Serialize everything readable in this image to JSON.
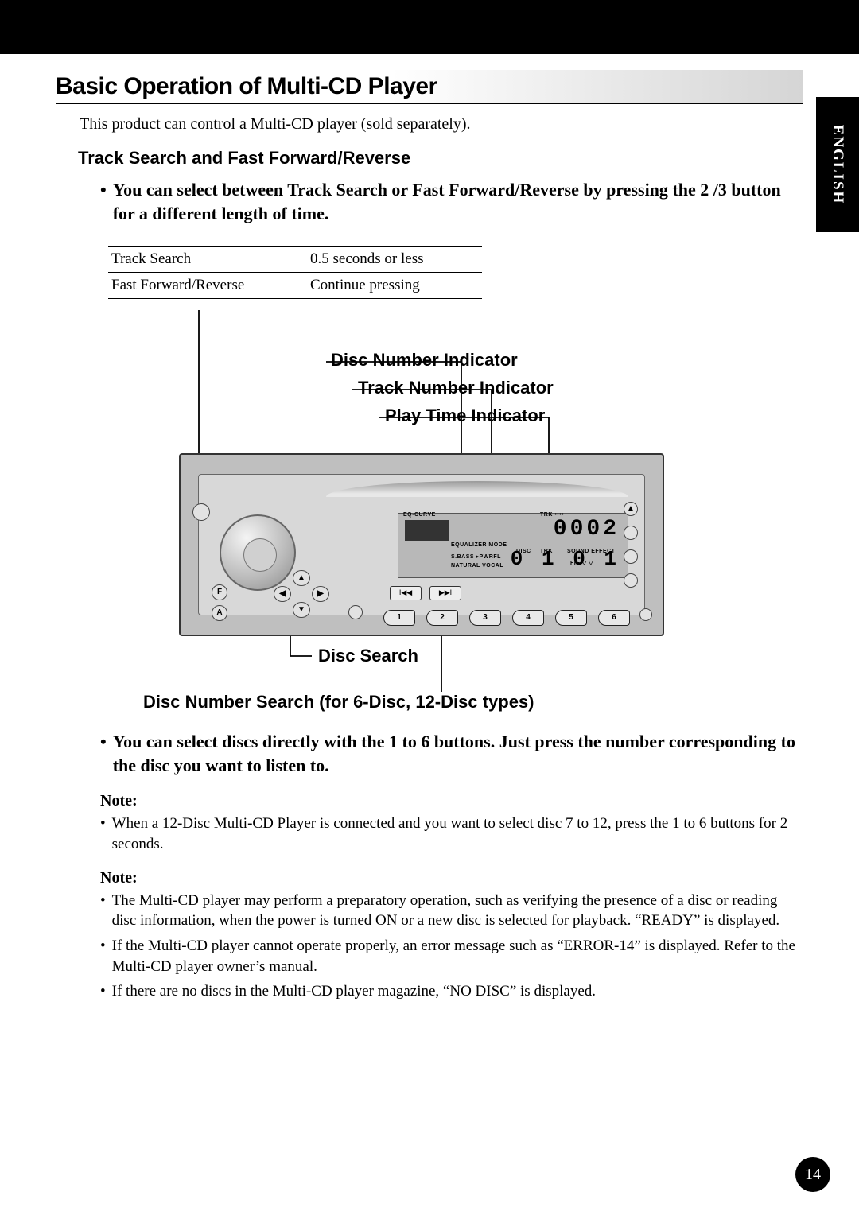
{
  "sideTab": "ENGLISH",
  "pageNumber": "14",
  "title": "Basic Operation of Multi-CD Player",
  "intro": "This product can control a Multi-CD player (sold separately).",
  "sub1": "Track Search and Fast Forward/Reverse",
  "bold1_pre": "You can select between Track Search or Fast Forward/Reverse by pressing the ",
  "bold1_btn": "2 /3",
  "bold1_post": "  button for a different length of time.",
  "table": {
    "r1c1": "Track Search",
    "r1c2": "0.5 seconds or less",
    "r2c1": "Fast Forward/Reverse",
    "r2c2": "Continue pressing"
  },
  "callouts": {
    "discNum": "Disc Number Indicator",
    "trackNum": "Track Number Indicator",
    "playTime": "Play Time Indicator",
    "discSearch": "Disc Search",
    "discNumSearch": "Disc Number Search (for 6-Disc, 12-Disc types)"
  },
  "lcd": {
    "segTop": "0002",
    "segBot": "0 1 0 1",
    "eqLabel": "EQ-CURVE",
    "equalizerMode": "EQUALIZER MODE",
    "sbass": "S.BASS  ▸PWRFL",
    "natural": "NATURAL  VOCAL",
    "disc": "DISC",
    "trk": "TRK",
    "soundEffect": "SOUND EFFECT",
    "fie": "FIE  ▽ ▽"
  },
  "knob_labels": {
    "f": "F",
    "a": "A"
  },
  "presets": [
    "1",
    "2",
    "3",
    "4",
    "5",
    "6"
  ],
  "midBtns": {
    "prev": "I◀◀",
    "next": "▶▶I"
  },
  "bold2": "You can select discs directly with the 1 to 6 buttons. Just press the number corresponding to the disc you want to listen to.",
  "noteLabel": "Note:",
  "note1_a": "When a 12-Disc Multi-CD Player is connected and you want to select disc 7 to 12, press the 1 to 6 buttons for 2 seconds.",
  "note2_a": "The Multi-CD player may perform a preparatory operation, such as verifying the presence of a disc or reading disc information, when the power is turned ON or a new disc is selected for playback. “READY” is displayed.",
  "note2_b": "If the Multi-CD player cannot operate properly, an error message such as “ERROR-14” is displayed. Refer to the Multi-CD player owner’s manual.",
  "note2_c": "If there are no discs in the Multi-CD player magazine, “NO DISC” is displayed."
}
